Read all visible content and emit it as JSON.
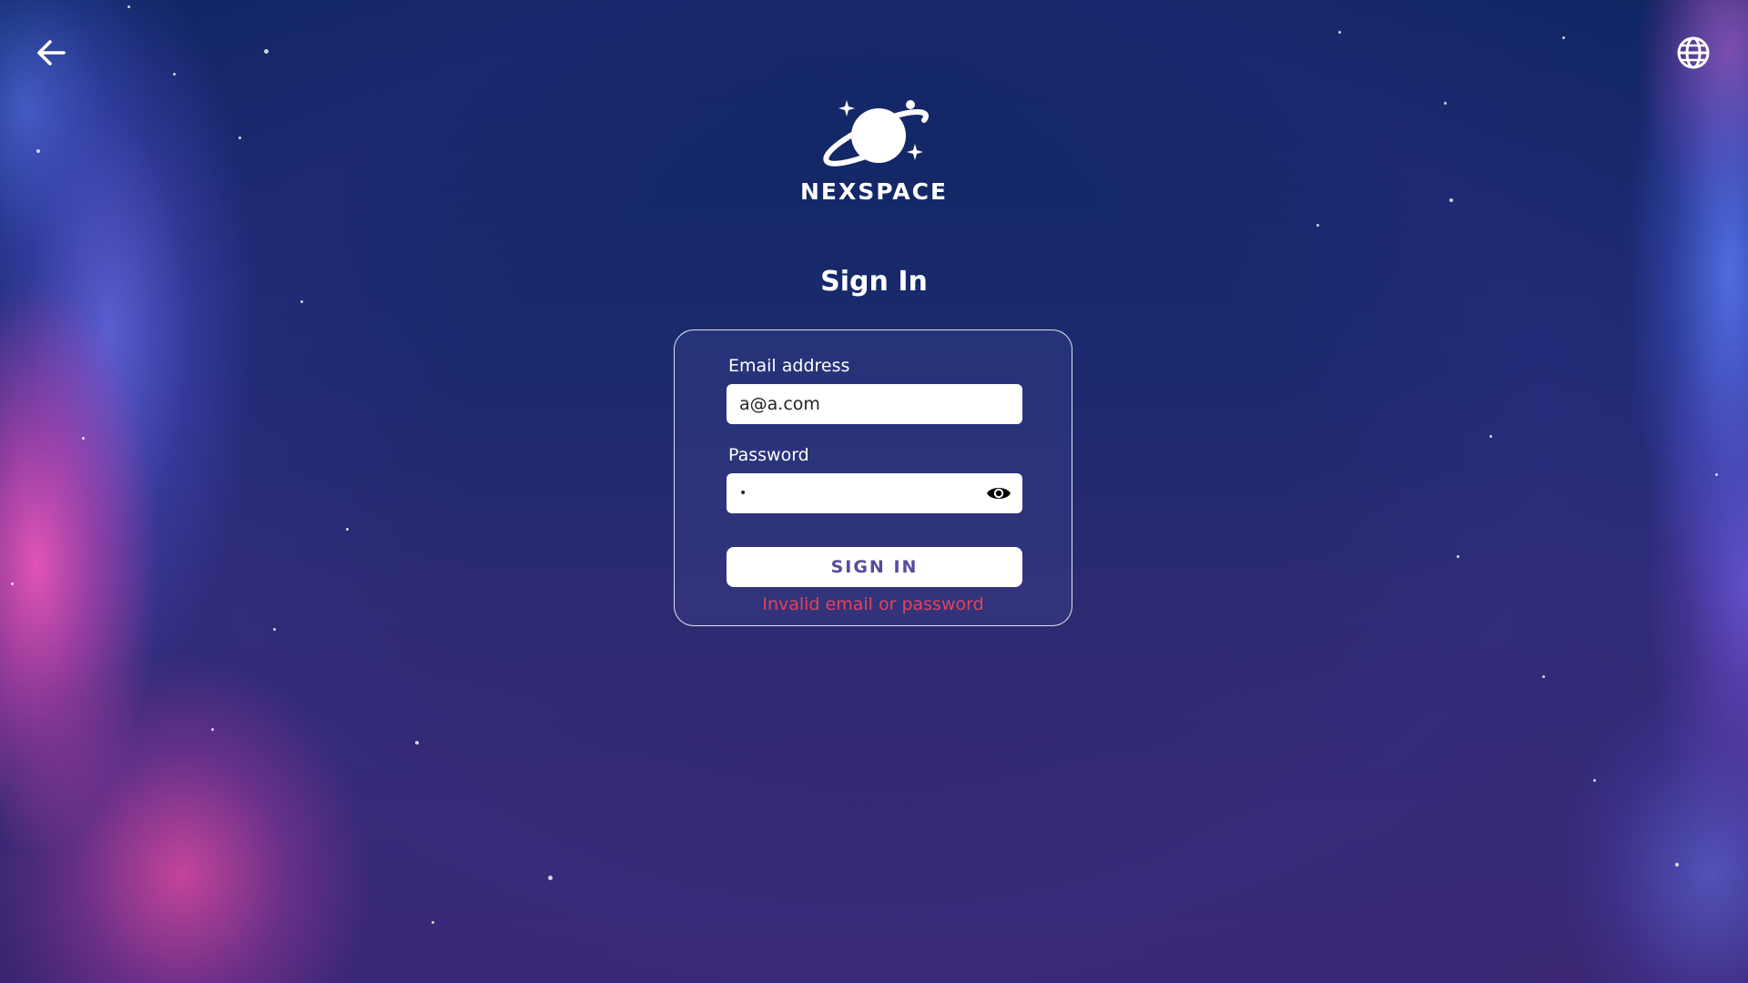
{
  "brand": {
    "name": "NEXSPACE",
    "logo_icon": "planet-icon"
  },
  "header": {
    "back_icon": "arrow-left-icon",
    "language_icon": "globe-icon"
  },
  "page": {
    "title": "Sign In"
  },
  "form": {
    "email": {
      "label": "Email address",
      "value": "a@a.com"
    },
    "password": {
      "label": "Password",
      "value": "•",
      "toggle_icon": "eye-icon"
    },
    "submit_label": "SIGN  IN",
    "error_message": "Invalid email or password"
  },
  "colors": {
    "button_text": "#5b4a9e",
    "error": "#e2445c",
    "card_border": "#ffffff"
  }
}
